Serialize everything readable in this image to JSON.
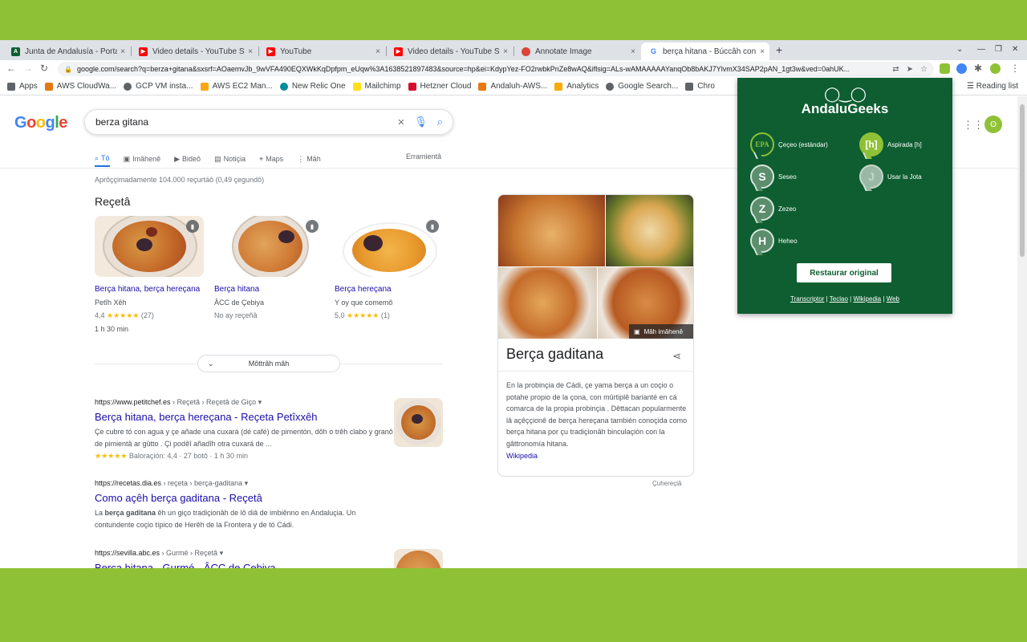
{
  "browser": {
    "tabs": [
      {
        "label": "Junta de Andalusía - Portal",
        "fav_color": "#0e5e31",
        "fav_char": "A"
      },
      {
        "label": "Video details - YouTube Studio",
        "fav_color": "#ff0000",
        "fav_char": "▶"
      },
      {
        "label": "YouTube",
        "fav_color": "#ff0000",
        "fav_char": "▶"
      },
      {
        "label": "Video details - YouTube Studio",
        "fav_color": "#ff0000",
        "fav_char": "▶"
      },
      {
        "label": "Annotate Image",
        "fav_color": "#db4437",
        "fav_char": "●"
      },
      {
        "label": "berça hitana - Búccâh con Google",
        "fav_color": "#ffffff",
        "fav_char": "G"
      }
    ],
    "close_glyph": "×",
    "newtab_glyph": "+",
    "url": "google.com/search?q=berza+gitana&sxsrf=AOaemvJb_9wVFA490EQXWkKqDpfpm_eUqw%3A1638521897483&source=hp&ei=KdypYez-FO2rwbkPnZe8wAQ&iflsig=ALs-wAMAAAAAYanqOb8bAKJ7YlvmX34SAP2pAN_1gt3w&ved=0ahUK...",
    "reading_list": "Reading list",
    "bookmarks": [
      {
        "label": "Apps",
        "color": "#5f6368"
      },
      {
        "label": "AWS CloudWa...",
        "color": "#e47911"
      },
      {
        "label": "GCP VM insta...",
        "color": "#5f6368"
      },
      {
        "label": "AWS EC2 Man...",
        "color": "#f7a80d"
      },
      {
        "label": "New Relic One",
        "color": "#008c99"
      },
      {
        "label": "Mailchimp",
        "color": "#ffe01b"
      },
      {
        "label": "Hetzner Cloud",
        "color": "#d50c2d"
      },
      {
        "label": "Andaluh-AWS...",
        "color": "#e47911"
      },
      {
        "label": "Analytics",
        "color": "#f9ab00"
      },
      {
        "label": "Google Search...",
        "color": "#5f6368"
      },
      {
        "label": "Chro",
        "color": "#5f6368"
      }
    ]
  },
  "google": {
    "logo": "Google",
    "query": "berza gitana",
    "tabs": [
      {
        "label": "Tó",
        "icon": "🔍"
      },
      {
        "label": "Imâhenê",
        "icon": "▣"
      },
      {
        "label": "Bideô",
        "icon": "▶"
      },
      {
        "label": "Notiçia",
        "icon": "▤"
      },
      {
        "label": "Maps",
        "icon": "⌖"
      },
      {
        "label": "Mâh",
        "icon": "⋮"
      }
    ],
    "tools": "Erramientâ",
    "stats": "Aprôççimadamente 104.000 reçurtáô (0,49 çegundô)",
    "recipes_heading": "Reçetâ",
    "recipes": [
      {
        "title": "Berça hitana, berça hereçana",
        "source": "Petîh Xêh",
        "rating": "4,4",
        "stars": "★★★★★",
        "count": "(27)",
        "time": "1 h 30 min"
      },
      {
        "title": "Berça hitana",
        "source": "ÂCC de Çebiya",
        "rating": "No ay reçeñâ",
        "stars": "",
        "count": "",
        "time": ""
      },
      {
        "title": "Berça hereçana",
        "source": "Y oy que comemô",
        "rating": "5,0",
        "stars": "★★★★★",
        "count": "(1)",
        "time": ""
      }
    ],
    "more_button": "Môttrâh mâh",
    "results": [
      {
        "cite": "https://www.petitchef.es",
        "path": " › Reçetâ › Reçetâ de Giço",
        "title": "Berça hitana, berça hereçana - Reçeta Petîxxêh",
        "snippet": "Çe cubre tó con agua y çe añade una cuxará (dé café) de pimentón, dôh o trêh clabo y granô de pimientâ ar gûtto . Çi podêî añadîh otra cuxará de ...",
        "rating": "★★★★★",
        "rating_text": "Baloraçión: 4,4 · 27 botô · 1 h 30 min"
      },
      {
        "cite": "https://recetas.dia.es",
        "path": " › reçeta › berça-gaditana",
        "title": "Como açêh berça gaditana - Reçetâ",
        "snippet_pre": "La ",
        "snippet_bold": "berça gaditana",
        "snippet_post": " êh un giço tradiçionâh de lô diâ de imbiênno en Andaluçia. Un contundente coçio típico de Herêh de la Frontera y de tó Cádi."
      },
      {
        "cite": "https://sevilla.abc.es",
        "path": " › Gurmé › Reçetâ",
        "title": "Berça hitana - Gurmé - ÂCC de Çebiya"
      }
    ],
    "knowledge_panel": {
      "title": "Berça gaditana",
      "more_images": "Mâh imâhenê",
      "description": "En la probinçia de Cádi, çe yama berça a un coçio o potahe propio de la çona, con mûrtiplê barianté en cá comarca de la propia probinçia . Dêttacan popularmente lâ açêççionê de berça hereçana también conoçida como berça hitana por çu tradiçionâh binculaçión con la gâttronomía hitana.",
      "source": "Wikipedia"
    },
    "feedback": "Çuhereçiâ"
  },
  "extension": {
    "logo": "AndaluGeeks",
    "options": [
      {
        "label": "Çeçeo (estándar)",
        "badge": "EPA"
      },
      {
        "label": "Aspirada [h]",
        "badge": "[h]"
      },
      {
        "label": "Seseo",
        "badge": "S"
      },
      {
        "label": "Usar la Jota",
        "badge": "J"
      },
      {
        "label": "Zezeo",
        "badge": "Z"
      },
      {
        "label": "Heheo",
        "badge": "H"
      }
    ],
    "restore_button": "Restaurar original",
    "links": [
      "Transcriptor",
      "Teclao",
      "Wikipedia",
      "Web"
    ],
    "link_separator": "|"
  }
}
